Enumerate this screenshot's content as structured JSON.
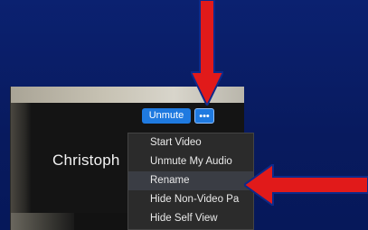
{
  "meeting": {
    "participant_name": "Christoph",
    "unmute_label": "Unmute",
    "more_label": "•••"
  },
  "menu": {
    "items": [
      {
        "label": "Start Video"
      },
      {
        "label": "Unmute My Audio"
      },
      {
        "label": "Rename"
      },
      {
        "label": "Hide Non-Video Pa"
      },
      {
        "label": "Hide Self View"
      }
    ]
  },
  "colors": {
    "slide_background": "#0a1f63",
    "button_blue": "#1f7ae0",
    "arrow_red": "#e11a1a",
    "menu_background": "#2b2b2b"
  },
  "annotations": {
    "down_arrow": "red-arrow-icon",
    "left_arrow": "red-arrow-icon"
  }
}
